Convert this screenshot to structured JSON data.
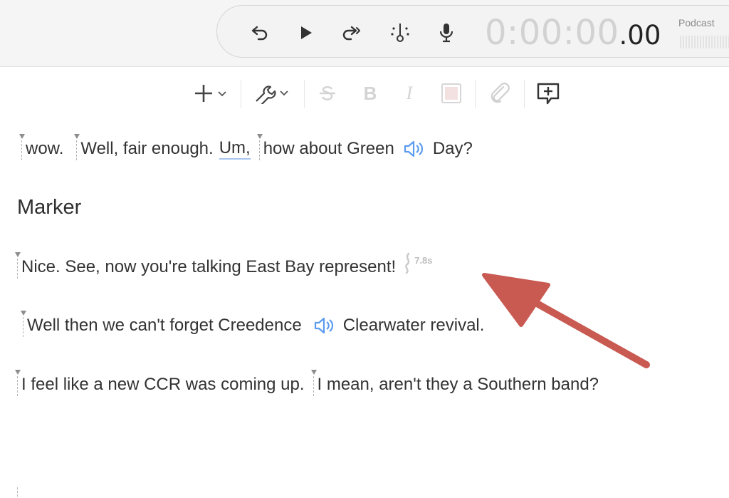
{
  "transport": {
    "time_main": "0:00:00",
    "time_fraction": ".00",
    "track_label": "Podcast",
    "buttons": [
      "skip-back-icon",
      "play-icon",
      "skip-forward-icon",
      "playhead-icon",
      "microphone-icon"
    ]
  },
  "toolbar": {
    "items": [
      "plus-icon",
      "wrench-icon",
      "strikethrough-icon",
      "bold-icon",
      "italic-icon",
      "highlight-icon",
      "link-icon",
      "add-comment-icon"
    ],
    "bold_glyph": "B",
    "italic_glyph": "I"
  },
  "script": {
    "line1": [
      "wow.",
      "Well, fair enough.",
      "Um,",
      "how about Green",
      "Day?"
    ],
    "heading": "Marker",
    "line2": [
      "Nice. See, now you're talking East Bay represent!"
    ],
    "gap_duration": "7.8s",
    "line3": [
      "Well then we can't forget Creedence",
      "Clearwater revival."
    ],
    "line4": [
      "I feel like a new CCR was coming up.",
      "I mean, aren't they a Southern band?"
    ]
  },
  "colors": {
    "accent_blue": "#5b9bf0",
    "annotation_arrow": "#c85a52"
  }
}
